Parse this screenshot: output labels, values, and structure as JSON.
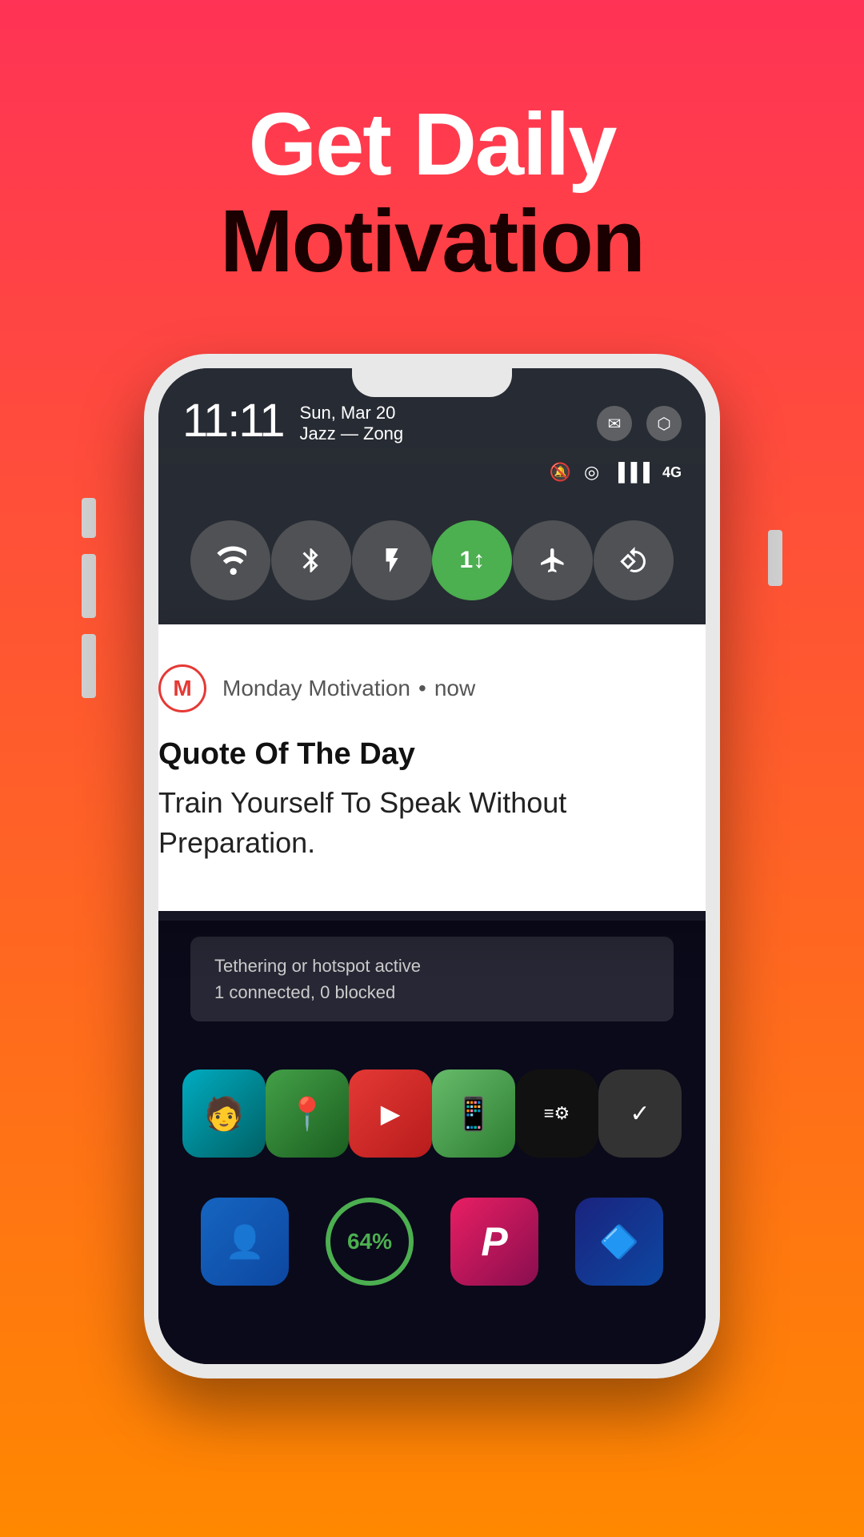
{
  "hero": {
    "line1": "Get Daily",
    "line2": "Motivation"
  },
  "phone": {
    "status": {
      "time": "11:11",
      "date": "Sun, Mar 20",
      "carrier": "Jazz — Zong"
    },
    "notification": {
      "app_name": "Monday Motivation",
      "app_icon_letter": "M",
      "time": "now",
      "title": "Quote Of The Day",
      "body": "Train Yourself To Speak Without Preparation."
    },
    "tethering": {
      "line1": "Tethering or hotspot active",
      "line2": "1 connected, 0 blocked"
    },
    "home_icons_row1": [
      {
        "label": "🧑",
        "style": "teal"
      },
      {
        "label": "📍",
        "style": "green"
      },
      {
        "label": "▶",
        "style": "red-yt"
      },
      {
        "label": "📱",
        "style": "green2"
      },
      {
        "label": "≡⚙",
        "style": "dark-menu"
      },
      {
        "label": "✓",
        "style": "gray-check"
      }
    ],
    "home_icons_row2": [
      {
        "label": "👤",
        "style": "blue"
      },
      {
        "label": "64%",
        "style": "green-ring"
      },
      {
        "label": "P",
        "style": "pink"
      },
      {
        "label": "🔷",
        "style": "dark-blue"
      }
    ]
  },
  "colors": {
    "bg_top": "#ff3355",
    "bg_bottom": "#ff8800",
    "hero_line1_color": "#ffffff",
    "hero_line2_color": "#1a0000",
    "notification_bg": "#ffffff",
    "app_icon_border": "#e53935"
  }
}
